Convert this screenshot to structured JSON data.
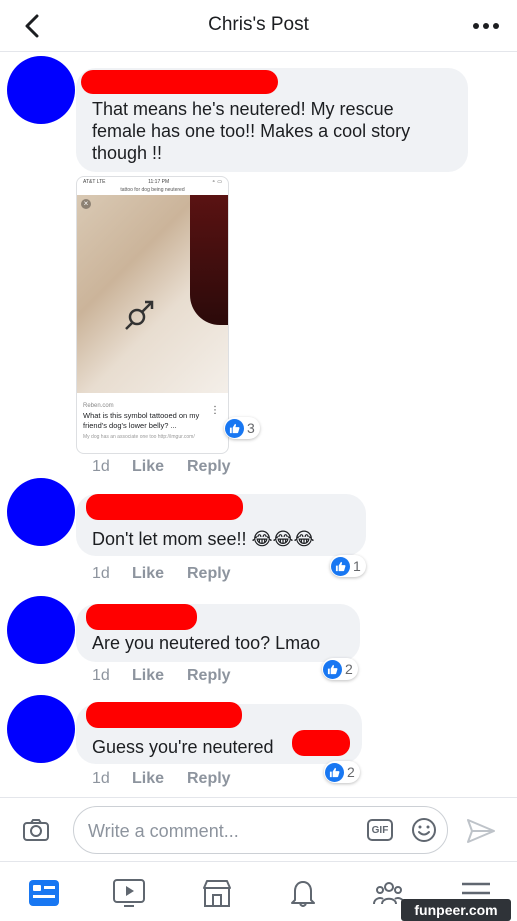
{
  "header": {
    "title": "Chris's Post"
  },
  "comments": [
    {
      "text_lines": [
        "That means he's neutered!   My rescue",
        "female has one too!!  Makes a cool story",
        "though !!"
      ],
      "time": "1d",
      "like": "Like",
      "reply": "Reply",
      "reactions": "3",
      "attachment": {
        "status_carrier": "AT&T  LTE",
        "status_time": "11:17 PM",
        "url": "tattoo for dog being neutered",
        "source": "Reben.com",
        "title": "What is this symbol tattooed on my friend's dog's lower belly? ...",
        "subtitle": "My dog has an associate one too http://imgur.com/"
      }
    },
    {
      "text": "Don't let mom see!! 😂😂😂",
      "time": "1d",
      "like": "Like",
      "reply": "Reply",
      "reactions": "1"
    },
    {
      "text": "Are you neutered too? Lmao",
      "time": "1d",
      "like": "Like",
      "reply": "Reply",
      "reactions": "2"
    },
    {
      "text": "Guess you're neutered",
      "time": "1d",
      "like": "Like",
      "reply": "Reply",
      "reactions": "2"
    }
  ],
  "composer": {
    "placeholder": "Write a comment...",
    "gif_label": "GIF"
  },
  "tabs": [
    "news-feed",
    "watch",
    "marketplace",
    "notifications",
    "groups",
    "menu"
  ],
  "watermark": "funpeer.com",
  "colors": {
    "avatar": "#0000ff",
    "redaction": "#ff0000",
    "accent": "#1877f2"
  }
}
